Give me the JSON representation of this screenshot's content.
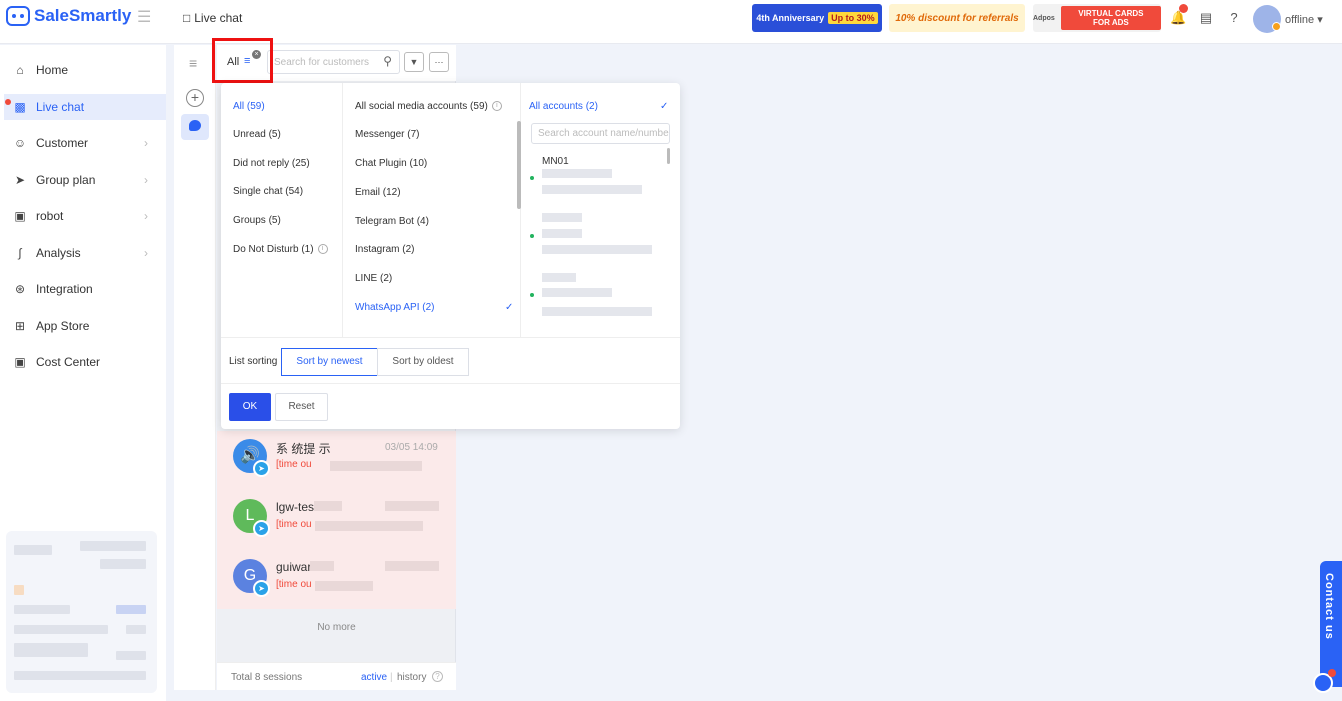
{
  "brand": {
    "name": "SaleSmartly",
    "color": "#2a62f5"
  },
  "header": {
    "page_title": "Live chat",
    "banners": [
      {
        "text": "4th Anniversary",
        "tag": "Up to 30%"
      },
      {
        "text": "10% discount for referrals"
      },
      {
        "logo": "Adpos",
        "text": "VIRTUAL CARDS FOR ADS"
      }
    ],
    "user_status": "offline"
  },
  "sidebar": {
    "items": [
      {
        "label": "Home",
        "icon": "home-icon"
      },
      {
        "label": "Live chat",
        "icon": "chat-icon",
        "active": true
      },
      {
        "label": "Customer",
        "icon": "users-icon"
      },
      {
        "label": "Group plan",
        "icon": "send-icon"
      },
      {
        "label": "robot",
        "icon": "robot-icon"
      },
      {
        "label": "Analysis",
        "icon": "chart-icon"
      },
      {
        "label": "Integration",
        "icon": "integration-icon"
      },
      {
        "label": "App Store",
        "icon": "grid-icon"
      },
      {
        "label": "Cost Center",
        "icon": "wallet-icon"
      }
    ]
  },
  "list": {
    "filter_label": "All",
    "search_placeholder": "Search for customers",
    "conversations": [
      {
        "name": "系 统提 示",
        "time": "03/05 14:09",
        "message": "[time ou",
        "avatar_letter": "",
        "avatar_color": "#3a8be8"
      },
      {
        "name": "lgw-tes",
        "time": "",
        "message": "[time ou",
        "avatar_letter": "L",
        "avatar_color": "#5fba5b"
      },
      {
        "name": "guiwar",
        "time": "",
        "message": "[time ou",
        "avatar_letter": "G",
        "avatar_color": "#5b82e0"
      }
    ],
    "no_more": "No more",
    "footer": {
      "total": "Total 8 sessions",
      "active": "active",
      "history": "history"
    }
  },
  "filter_panel": {
    "status_options": [
      "All (59)",
      "Unread (5)",
      "Did not reply (25)",
      "Single chat (54)",
      "Groups (5)",
      "Do Not Disturb (1)"
    ],
    "channel_options": [
      "All social media accounts (59)",
      "Messenger (7)",
      "Chat Plugin (10)",
      "Email (12)",
      "Telegram Bot (4)",
      "Instagram (2)",
      "LINE (2)",
      "WhatsApp API (2)"
    ],
    "accounts": {
      "all_label": "All accounts (2)",
      "search_placeholder": "Search account name/number",
      "first_account": "MN01"
    },
    "sorting": {
      "label": "List sorting",
      "newest": "Sort by newest",
      "oldest": "Sort by oldest"
    },
    "ok": "OK",
    "reset": "Reset"
  },
  "contact_us": "Contact us"
}
